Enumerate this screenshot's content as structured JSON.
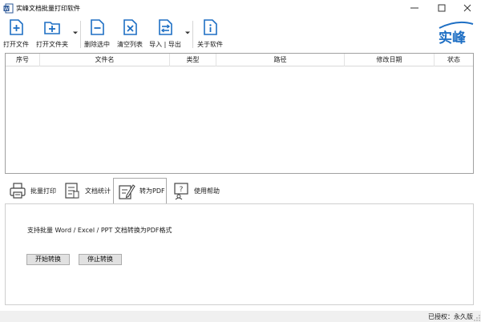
{
  "window": {
    "title": "实峰文档批量打印软件",
    "buttons": [
      {
        "name": "minimize-button",
        "icon": "minimize-icon"
      },
      {
        "name": "maximize-button",
        "icon": "maximize-icon"
      },
      {
        "name": "close-button",
        "icon": "close-icon"
      }
    ]
  },
  "toolbar": {
    "items": [
      {
        "label": "打开文件",
        "icon": "file-add-icon"
      },
      {
        "label": "打开文件夹",
        "icon": "folder-add-icon",
        "has_dropdown": true
      },
      {
        "label": "删除选中",
        "icon": "delete-selected-icon"
      },
      {
        "label": "清空列表",
        "icon": "clear-list-icon"
      },
      {
        "label": "导入 | 导出",
        "icon": "import-export-icon",
        "has_dropdown": true
      },
      {
        "label": "关于软件",
        "icon": "about-icon"
      }
    ],
    "logo_text": "实峰",
    "accent_color": "#1e6fc4"
  },
  "table": {
    "columns": [
      "序号",
      "文件名",
      "类型",
      "路径",
      "修改日期",
      "状态"
    ],
    "rows": []
  },
  "tabs": [
    {
      "label": "批量打印",
      "icon": "printer-icon",
      "active": false
    },
    {
      "label": "文档统计",
      "icon": "document-stats-icon",
      "active": false
    },
    {
      "label": "转为PDF",
      "icon": "pdf-convert-icon",
      "active": true
    },
    {
      "label": "使用帮助",
      "icon": "help-icon",
      "active": false
    }
  ],
  "panel": {
    "description": "支持批量 Word / Excel / PPT 文档转换为PDF格式",
    "start_button": "开始转换",
    "stop_button": "停止转换"
  },
  "status": {
    "license": "已授权：永久版"
  }
}
